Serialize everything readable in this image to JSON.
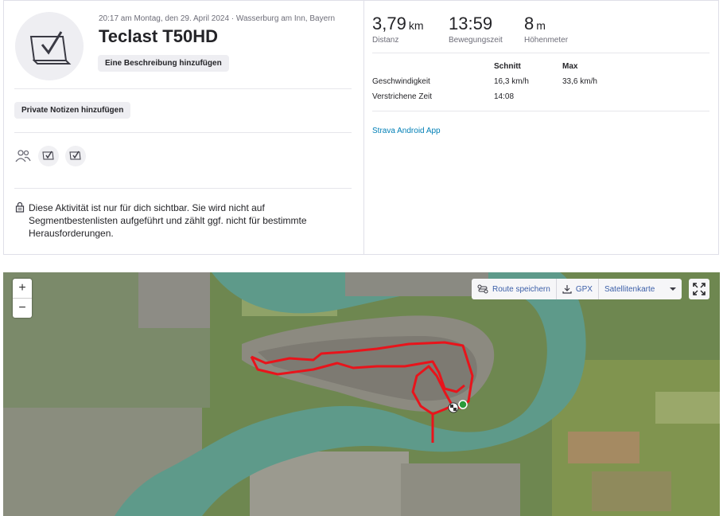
{
  "activity": {
    "meta": "20:17 am Montag, den 29. April 2024 · Wasserburg am Inn, Bayern",
    "title": "Teclast T50HD",
    "add_description_label": "Eine Beschreibung hinzufügen",
    "private_notes_label": "Private Notizen hinzufügen",
    "privacy_notice": "Diese Aktivität ist nur für dich sichtbar. Sie wird nicht auf Segmentbestenlisten aufgeführt und zählt ggf. nicht für bestimmte Herausforderungen."
  },
  "stats": {
    "distance": {
      "value": "3,79",
      "unit": "km",
      "label": "Distanz"
    },
    "moving_time": {
      "value": "13:59",
      "label": "Bewegungszeit"
    },
    "elevation": {
      "value": "8",
      "unit": "m",
      "label": "Höhenmeter"
    }
  },
  "details": {
    "headers": {
      "avg": "Schnitt",
      "max": "Max"
    },
    "rows": [
      {
        "label": "Geschwindigkeit",
        "avg": "16,3 km/h",
        "max": "33,6 km/h"
      },
      {
        "label": "Verstrichene Zeit",
        "avg": "14:08",
        "max": ""
      }
    ]
  },
  "device_link": "Strava Android App",
  "map": {
    "zoom_in": "+",
    "zoom_out": "−",
    "save_route_label": "Route speichern",
    "gpx_label": "GPX",
    "map_type_label": "Satellitenkarte",
    "route_color": "#e8141b"
  }
}
